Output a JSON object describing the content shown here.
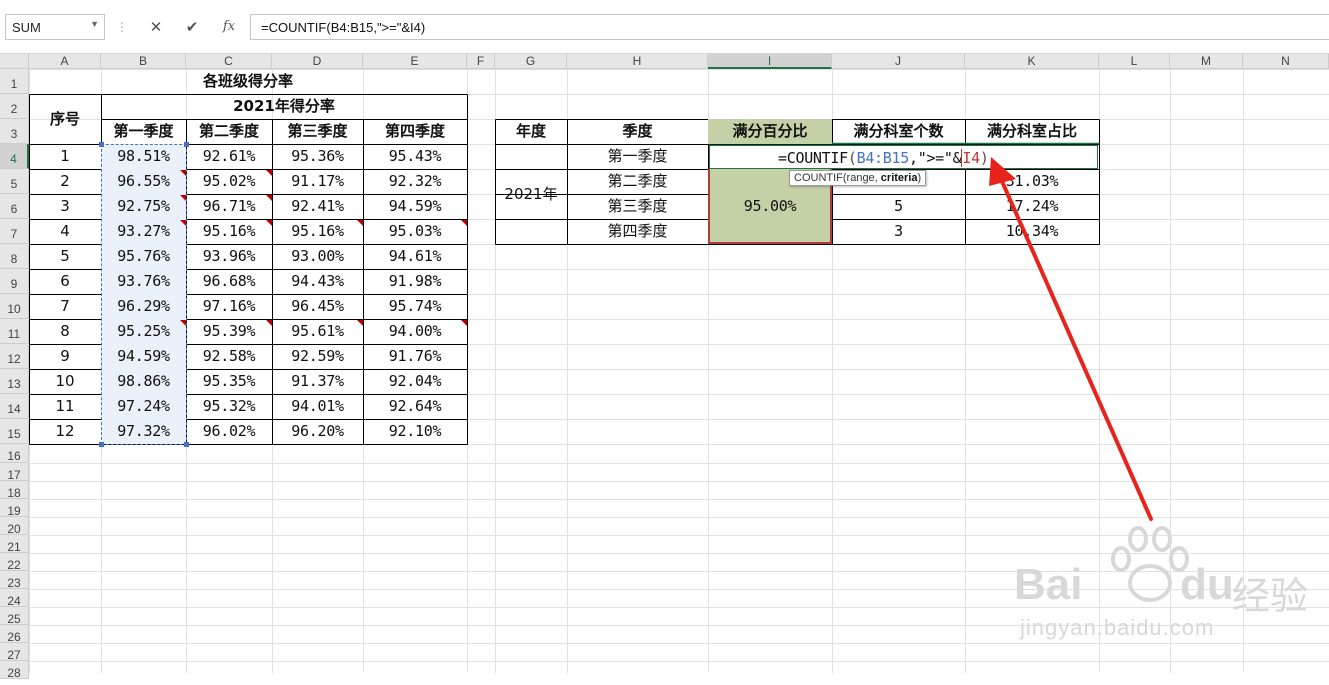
{
  "formula_bar": {
    "name_box": "SUM",
    "cancel_glyph": "✕",
    "enter_glyph": "✔",
    "fx_label": "fx",
    "formula": "=COUNTIF(B4:B15,\">=\"&I4)"
  },
  "columns": [
    "A",
    "B",
    "C",
    "D",
    "E",
    "F",
    "G",
    "H",
    "I",
    "J",
    "K",
    "L",
    "M",
    "N"
  ],
  "rows": [
    "1",
    "2",
    "3",
    "4",
    "5",
    "6",
    "7",
    "8",
    "9",
    "10",
    "11",
    "12",
    "13",
    "14",
    "15",
    "16",
    "17",
    "18",
    "19",
    "20",
    "21",
    "22",
    "23",
    "24",
    "25",
    "26",
    "27",
    "28"
  ],
  "left_table": {
    "title": "各班级得分率",
    "subtitle": "2021年得分率",
    "index_header": "序号",
    "quarter_headers": [
      "第一季度",
      "第二季度",
      "第三季度",
      "第四季度"
    ],
    "rows": [
      {
        "no": "1",
        "q": [
          "98.51%",
          "92.61%",
          "95.36%",
          "95.43%"
        ]
      },
      {
        "no": "2",
        "q": [
          "96.55%",
          "95.02%",
          "91.17%",
          "92.32%"
        ]
      },
      {
        "no": "3",
        "q": [
          "92.75%",
          "96.71%",
          "92.41%",
          "94.59%"
        ]
      },
      {
        "no": "4",
        "q": [
          "93.27%",
          "95.16%",
          "95.16%",
          "95.03%"
        ]
      },
      {
        "no": "5",
        "q": [
          "95.76%",
          "93.96%",
          "93.00%",
          "94.61%"
        ]
      },
      {
        "no": "6",
        "q": [
          "93.76%",
          "96.68%",
          "94.43%",
          "91.98%"
        ]
      },
      {
        "no": "7",
        "q": [
          "96.29%",
          "97.16%",
          "96.45%",
          "95.74%"
        ]
      },
      {
        "no": "8",
        "q": [
          "95.25%",
          "95.39%",
          "95.61%",
          "94.00%"
        ]
      },
      {
        "no": "9",
        "q": [
          "94.59%",
          "92.58%",
          "92.59%",
          "91.76%"
        ]
      },
      {
        "no": "10",
        "q": [
          "98.86%",
          "95.35%",
          "91.37%",
          "92.04%"
        ]
      },
      {
        "no": "11",
        "q": [
          "97.24%",
          "95.32%",
          "94.01%",
          "92.64%"
        ]
      },
      {
        "no": "12",
        "q": [
          "97.32%",
          "96.02%",
          "96.20%",
          "92.10%"
        ]
      }
    ]
  },
  "right_table": {
    "headers": [
      "年度",
      "季度",
      "满分百分比",
      "满分科室个数",
      "满分科室占比"
    ],
    "year": "2021年",
    "quarters": [
      "第一季度",
      "第二季度",
      "第三季度",
      "第四季度"
    ],
    "full_pct": "95.00%",
    "editing_formula": {
      "p1": "=COUNT",
      "p2": "IF",
      "p3": "(",
      "p4": "B4:B15",
      "p5": ",\">=\"&",
      "p6": "I4",
      "p7": ")"
    },
    "counts": [
      "",
      "",
      "5",
      "3"
    ],
    "ratios": [
      "",
      "31.03%",
      "17.24%",
      "10.34%"
    ]
  },
  "tooltip": {
    "fn": "COUNTIF(range, ",
    "arg": "criteria",
    "close": ")"
  },
  "watermark": {
    "brand": "Bai",
    "brand2": "du",
    "cn": "经验",
    "url": "jingyan.baidu.com"
  },
  "colors": {
    "accent_green": "#217346",
    "header_fill": "#c4d0a5",
    "arrow_red": "#e8231b",
    "ref_blue": "#4472c4",
    "ref_red": "#c0392b"
  }
}
